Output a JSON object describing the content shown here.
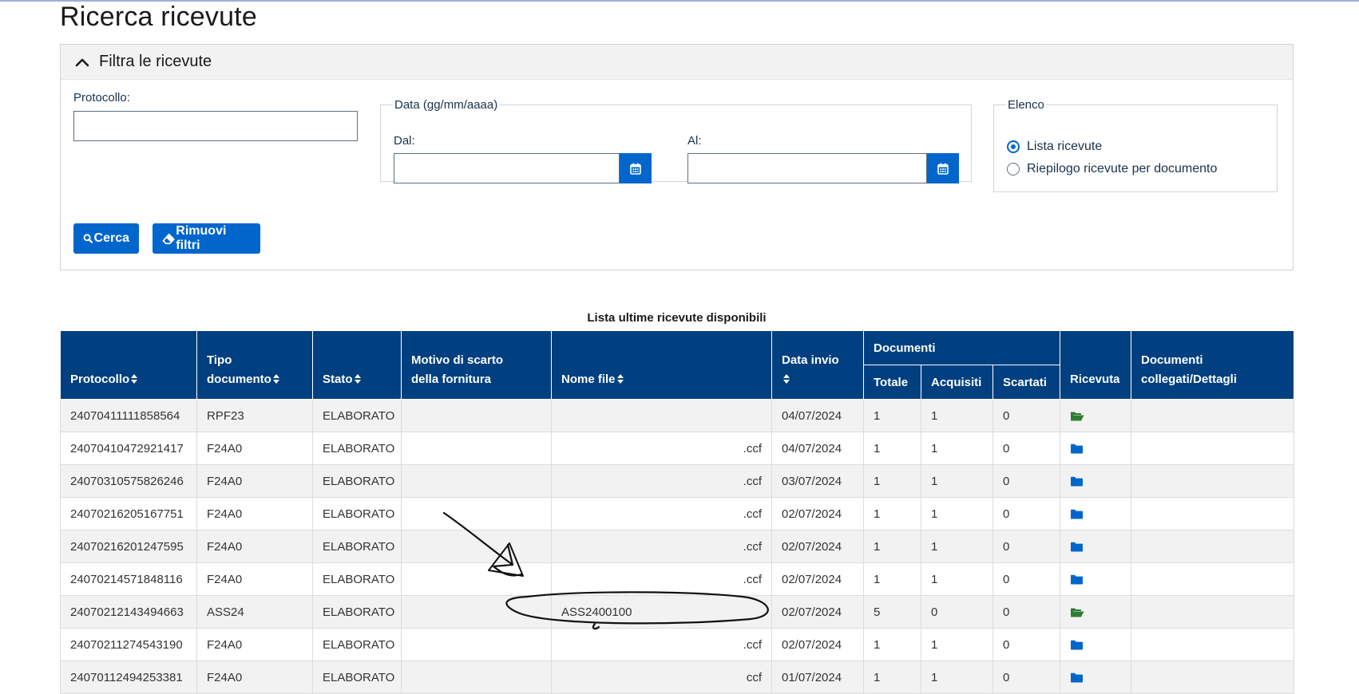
{
  "page": {
    "title": "Ricerca ricevute"
  },
  "filter": {
    "header": "Filtra le ricevute",
    "protocollo_label": "Protocollo:",
    "protocollo_value": "",
    "date_legend": "Data (gg/mm/aaaa)",
    "dal_label": "Dal:",
    "dal_value": "",
    "al_label": "Al:",
    "al_value": "",
    "elenco_legend": "Elenco",
    "elenco_options": [
      {
        "label": "Lista ricevute",
        "selected": true
      },
      {
        "label": "Riepilogo ricevute per documento",
        "selected": false
      }
    ],
    "cerca_label": "Cerca",
    "rimuovi_label": "Rimuovi filtri"
  },
  "table": {
    "caption": "Lista ultime ricevute disponibili",
    "headers": {
      "protocollo": "Protocollo",
      "tipo_documento_1": "Tipo",
      "tipo_documento_2": "documento",
      "stato": "Stato",
      "motivo_1": "Motivo di scarto",
      "motivo_2": "della fornitura",
      "nome_file": "Nome file",
      "data_invio": "Data invio",
      "documenti": "Documenti",
      "totale": "Totale",
      "acquisiti": "Acquisiti",
      "scartati": "Scartati",
      "ricevuta": "Ricevuta",
      "collegati_1": "Documenti",
      "collegati_2": "collegati/Dettagli"
    },
    "rows": [
      {
        "protocollo": "24070411111858564",
        "tipo": "RPF23",
        "stato": "ELABORATO",
        "motivo": "",
        "nome_file": "",
        "data": "04/07/2024",
        "totale": "1",
        "acquisiti": "1",
        "scartati": "0",
        "ricevuta_icon": "folder-open-icon"
      },
      {
        "protocollo": "24070410472921417",
        "tipo": "F24A0",
        "stato": "ELABORATO",
        "motivo": "",
        "nome_file": ".ccf",
        "data": "04/07/2024",
        "totale": "1",
        "acquisiti": "1",
        "scartati": "0",
        "ricevuta_icon": "folder-icon"
      },
      {
        "protocollo": "24070310575826246",
        "tipo": "F24A0",
        "stato": "ELABORATO",
        "motivo": "",
        "nome_file": ".ccf",
        "data": "03/07/2024",
        "totale": "1",
        "acquisiti": "1",
        "scartati": "0",
        "ricevuta_icon": "folder-icon"
      },
      {
        "protocollo": "24070216205167751",
        "tipo": "F24A0",
        "stato": "ELABORATO",
        "motivo": "",
        "nome_file": ".ccf",
        "data": "02/07/2024",
        "totale": "1",
        "acquisiti": "1",
        "scartati": "0",
        "ricevuta_icon": "folder-icon"
      },
      {
        "protocollo": "24070216201247595",
        "tipo": "F24A0",
        "stato": "ELABORATO",
        "motivo": "",
        "nome_file": ".ccf",
        "data": "02/07/2024",
        "totale": "1",
        "acquisiti": "1",
        "scartati": "0",
        "ricevuta_icon": "folder-icon"
      },
      {
        "protocollo": "24070214571848116",
        "tipo": "F24A0",
        "stato": "ELABORATO",
        "motivo": "",
        "nome_file": ".ccf",
        "data": "02/07/2024",
        "totale": "1",
        "acquisiti": "1",
        "scartati": "0",
        "ricevuta_icon": "folder-icon"
      },
      {
        "protocollo": "24070212143494663",
        "tipo": "ASS24",
        "stato": "ELABORATO",
        "motivo": "",
        "nome_file": "ASS2400100",
        "data": "02/07/2024",
        "totale": "5",
        "acquisiti": "0",
        "scartati": "0",
        "ricevuta_icon": "folder-open-icon"
      },
      {
        "protocollo": "24070211274543190",
        "tipo": "F24A0",
        "stato": "ELABORATO",
        "motivo": "",
        "nome_file": ".ccf",
        "data": "02/07/2024",
        "totale": "1",
        "acquisiti": "1",
        "scartati": "0",
        "ricevuta_icon": "folder-icon"
      },
      {
        "protocollo": "24070112494253381",
        "tipo": "F24A0",
        "stato": "ELABORATO",
        "motivo": "",
        "nome_file": "ccf",
        "data": "01/07/2024",
        "totale": "1",
        "acquisiti": "1",
        "scartati": "0",
        "ricevuta_icon": "folder-icon"
      }
    ]
  },
  "colors": {
    "primary": "#0066cc",
    "header_bg": "#004080",
    "folder_blue": "#0066cc",
    "folder_green": "#2e7d32"
  }
}
